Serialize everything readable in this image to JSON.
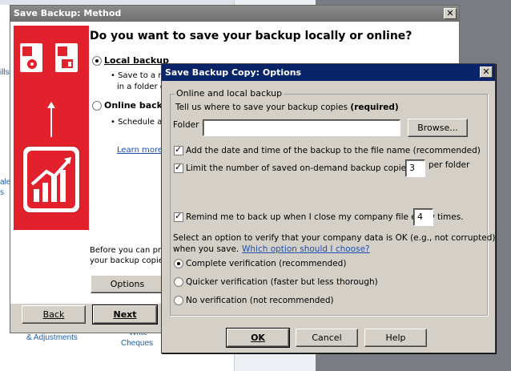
{
  "background": {
    "left_fragment": "ills",
    "left_fragment2": "ales",
    "left_fragment3": "s",
    "adjustments": "& Adjustments",
    "write": "Write",
    "cheques": "Cheques"
  },
  "method_dialog": {
    "title": "Save Backup: Method",
    "question": "Do you want to save your backup locally or online?",
    "local_label": "Local backup",
    "local_bullet1": "• Save to a r",
    "local_bullet2": "in a folder o",
    "online_label": "Online backu",
    "online_bullet": "• Schedule au",
    "learn_more": "Learn more",
    "before_text1": "Before you can pro",
    "before_text2": "your backup copies",
    "options_label": "Options",
    "back_label": "Back",
    "next_label": "Next",
    "close": "✕"
  },
  "options_dialog": {
    "title": "Save Backup Copy: Options",
    "close": "✕",
    "group_label": "Online and local backup",
    "tell_us": "Tell us where to save your backup copies",
    "required": "(required)",
    "folder_label": "Folder",
    "folder_value": "",
    "browse_label": "Browse...",
    "add_date_label": "Add the date and time of the backup to the file name (recommended)",
    "limit_label": "Limit the number of saved on-demand backup copies to",
    "limit_value": "3",
    "per_folder": "per folder",
    "remind_label": "Remind me to back up when I close my company file every",
    "remind_value": "4",
    "times": "times.",
    "verify_text1": "Select an option to verify that your company data is OK (e.g., not corrupted)",
    "verify_text2": "when you save.",
    "which_option": "Which option should I choose?",
    "complete_label": "Complete verification (recommended)",
    "quicker_label": "Quicker verification (faster but less thorough)",
    "no_label": "No verification (not recommended)",
    "ok_label": "OK",
    "cancel_label": "Cancel",
    "help_label": "Help"
  },
  "colors": {
    "accent_red": "#e3212d",
    "title_blue": "#0a246a",
    "link_blue": "#1f4fb0"
  },
  "icons": [
    "company-file-icon",
    "backup-disc-icon",
    "folder-icon",
    "arrow-up-icon",
    "quickbooks-chart-icon"
  ]
}
